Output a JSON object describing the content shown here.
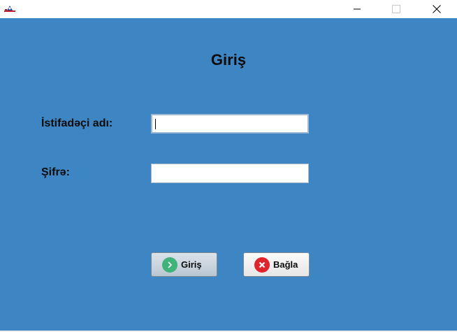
{
  "window": {
    "icon": "app-logo-icon",
    "controls": [
      "minimize-icon",
      "maximize-icon",
      "close-icon"
    ]
  },
  "form": {
    "title": "Giriş",
    "username_label": "İstifadəçi adı:",
    "username_value": "",
    "password_label": "Şifrə:",
    "password_value": ""
  },
  "buttons": {
    "login_label": "Giriş",
    "login_icon": "chevron-right-icon",
    "close_label": "Bağla",
    "close_icon": "x-circle-icon"
  },
  "colors": {
    "background": "#3e86c3",
    "login_icon": "#3fb37a",
    "close_icon": "#e0242c"
  }
}
